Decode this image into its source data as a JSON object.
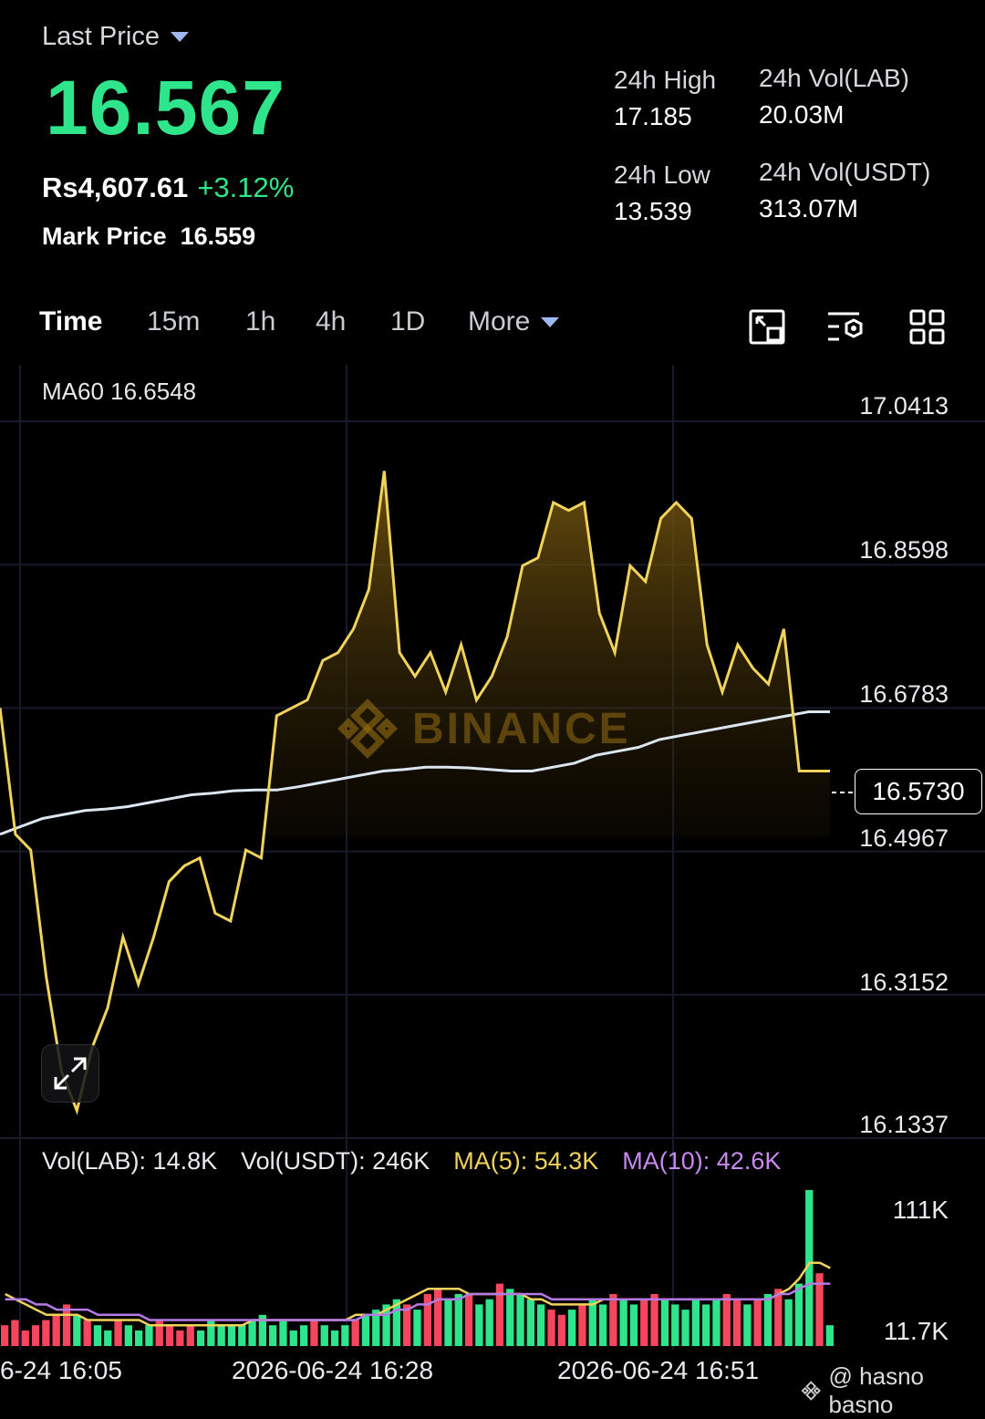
{
  "header": {
    "last_price_label": "Last Price",
    "last_price": "16.567",
    "fiat_price": "Rs4,607.61",
    "pct_change": "+3.12%",
    "mark_price_label": "Mark Price",
    "mark_price": "16.559"
  },
  "stats": {
    "high_label": "24h High",
    "high_value": "17.185",
    "low_label": "24h Low",
    "low_value": "13.539",
    "vol_lab_label": "24h Vol(LAB)",
    "vol_lab_value": "20.03M",
    "vol_usdt_label": "24h Vol(USDT)",
    "vol_usdt_value": "313.07M"
  },
  "tabs": [
    "Time",
    "15m",
    "1h",
    "4h",
    "1D",
    "More"
  ],
  "active_tab": "Time",
  "icons": [
    "fullscreen-icon",
    "chart-settings-icon",
    "layout-grid-icon",
    "expand-icon",
    "binance-logo-icon"
  ],
  "colors": {
    "up": "#2ee58b",
    "down": "#f6465d",
    "price_line": "#f0d35a",
    "ma60": "#dbe6f0",
    "ma5": "#f0d35a",
    "ma10": "#c88af0",
    "accent": "#9fb8f0"
  },
  "chart": {
    "ma60_label": "MA60 16.6548",
    "y_ticks": [
      "17.0413",
      "16.8598",
      "16.6783",
      "16.4967",
      "16.3152",
      "16.1337"
    ],
    "current_price": "16.5730",
    "watermark": "BINANCE"
  },
  "volume": {
    "vol_lab": "Vol(LAB): 14.8K",
    "vol_usdt": "Vol(USDT): 246K",
    "ma5": "MA(5): 54.3K",
    "ma10": "MA(10): 42.6K",
    "y_ticks": [
      "111K",
      "11.7K"
    ]
  },
  "time_axis": [
    "6-24 16:05",
    "2026-06-24 16:28",
    "2026-06-24 16:51"
  ],
  "watermark_user": "@ hasno basno",
  "chart_data": {
    "type": "line",
    "y_range": [
      16.1337,
      17.0413
    ],
    "price": [
      16.66,
      16.5,
      16.48,
      16.32,
      16.2,
      16.15,
      16.23,
      16.28,
      16.37,
      16.31,
      16.37,
      16.44,
      16.46,
      16.47,
      16.4,
      16.39,
      16.48,
      16.47,
      16.65,
      16.66,
      16.67,
      16.72,
      16.73,
      16.76,
      16.81,
      16.96,
      16.73,
      16.7,
      16.73,
      16.68,
      16.74,
      16.67,
      16.7,
      16.75,
      16.84,
      16.85,
      16.92,
      16.91,
      16.92,
      16.78,
      16.73,
      16.84,
      16.82,
      16.9,
      16.92,
      16.9,
      16.74,
      16.68,
      16.74,
      16.71,
      16.69,
      16.76,
      16.58,
      16.58,
      16.58
    ],
    "ma60": [
      16.5,
      16.51,
      16.52,
      16.525,
      16.53,
      16.532,
      16.535,
      16.54,
      16.545,
      16.55,
      16.552,
      16.555,
      16.556,
      16.556,
      16.56,
      16.565,
      16.57,
      16.575,
      16.58,
      16.582,
      16.585,
      16.585,
      16.584,
      16.582,
      16.58,
      16.58,
      16.585,
      16.59,
      16.6,
      16.605,
      16.61,
      16.62,
      16.625,
      16.63,
      16.635,
      16.64,
      16.645,
      16.65,
      16.655,
      16.655
    ],
    "volume_up": [
      0,
      0,
      0,
      0,
      0,
      0,
      0,
      1,
      0,
      1,
      1,
      0,
      1,
      1,
      1,
      0,
      0,
      0,
      0,
      1,
      1,
      1,
      1,
      1,
      1,
      1,
      1,
      1,
      1,
      1,
      0,
      1,
      1,
      1,
      0,
      1,
      1,
      1,
      1,
      0,
      1,
      0,
      0,
      1,
      1,
      0,
      1,
      1,
      0,
      1,
      1,
      1,
      1,
      0,
      0,
      1,
      0,
      1,
      1,
      0,
      1,
      1,
      0,
      0,
      1,
      1,
      1,
      1,
      1,
      1,
      0,
      0,
      1,
      0,
      1,
      0,
      1,
      1,
      1,
      0,
      1
    ],
    "volume": [
      4,
      5,
      3,
      4,
      5,
      6,
      8,
      6,
      5,
      4,
      3,
      5,
      4,
      3,
      4,
      5,
      4,
      3,
      4,
      3,
      5,
      4,
      4,
      4,
      5,
      6,
      4,
      5,
      3,
      4,
      5,
      4,
      3,
      4,
      5,
      6,
      7,
      8,
      9,
      8,
      7,
      10,
      11,
      9,
      10,
      10,
      8,
      9,
      12,
      11,
      10,
      9,
      8,
      7,
      6,
      7,
      8,
      9,
      8,
      10,
      9,
      8,
      9,
      10,
      9,
      8,
      7,
      9,
      8,
      9,
      10,
      9,
      8,
      9,
      10,
      11,
      9,
      12,
      30,
      14,
      4
    ],
    "ma5_vol": [
      10,
      9,
      8,
      7,
      6,
      6,
      6,
      6,
      5,
      5,
      5,
      5,
      5,
      5,
      4,
      4,
      4,
      4,
      4,
      4,
      4,
      4,
      4,
      4,
      5,
      5,
      5,
      5,
      5,
      5,
      5,
      5,
      5,
      5,
      6,
      6,
      6,
      7,
      8,
      9,
      10,
      11,
      11,
      11,
      11,
      10,
      10,
      10,
      10,
      10,
      10,
      9,
      9,
      8,
      8,
      8,
      8,
      8,
      9,
      9,
      9,
      9,
      9,
      9,
      9,
      9,
      9,
      9,
      9,
      9,
      9,
      9,
      9,
      9,
      9,
      10,
      11,
      13,
      16,
      16,
      15
    ],
    "ma10_vol": [
      9,
      9,
      9,
      8,
      8,
      7,
      7,
      7,
      7,
      6,
      6,
      6,
      6,
      6,
      5,
      5,
      5,
      5,
      5,
      5,
      5,
      5,
      5,
      5,
      5,
      5,
      5,
      5,
      5,
      5,
      5,
      5,
      5,
      5,
      5,
      6,
      6,
      6,
      7,
      7,
      8,
      8,
      9,
      9,
      9,
      10,
      10,
      10,
      10,
      10,
      10,
      10,
      10,
      9,
      9,
      9,
      9,
      9,
      9,
      9,
      9,
      9,
      9,
      9,
      9,
      9,
      9,
      9,
      9,
      9,
      9,
      9,
      9,
      9,
      9,
      10,
      10,
      11,
      12,
      12,
      12
    ]
  }
}
